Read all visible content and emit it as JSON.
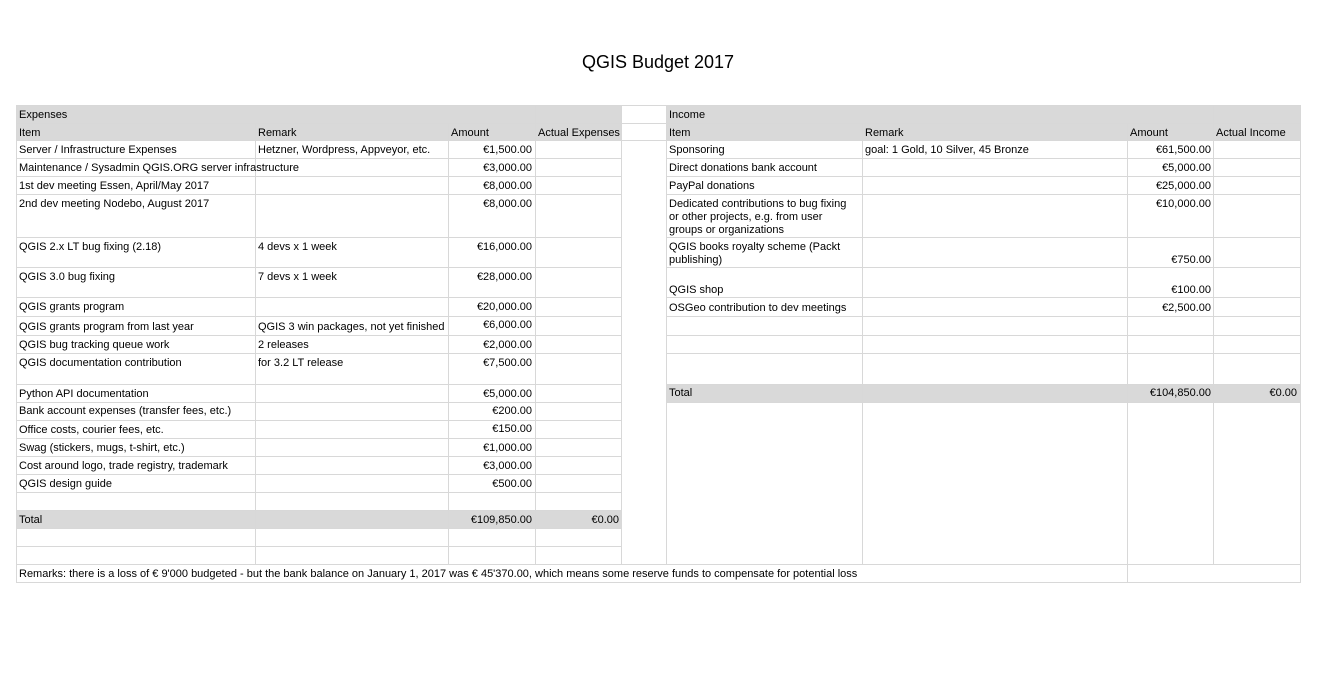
{
  "title": "QGIS Budget 2017",
  "expenses": {
    "section": "Expenses",
    "headers": {
      "item": "Item",
      "remark": "Remark",
      "amount": "Amount",
      "actual": "Actual Expenses"
    },
    "rows": [
      {
        "item": "Server / Infrastructure Expenses",
        "remark": "Hetzner, Wordpress, Appveyor, etc.",
        "amount": "€1,500.00"
      },
      {
        "item": "Maintenance / Sysadmin QGIS.ORG server infrastructure",
        "remark": "",
        "amount": "€3,000.00"
      },
      {
        "item": "1st dev meeting Essen, April/May 2017",
        "remark": "",
        "amount": "€8,000.00"
      },
      {
        "item": "2nd dev meeting Nodebo, August 2017",
        "remark": "",
        "amount": "€8,000.00"
      },
      {
        "item": "QGIS 2.x LT bug fixing (2.18)",
        "remark": "4 devs x 1 week",
        "amount": "€16,000.00"
      },
      {
        "item": "QGIS 3.0 bug fixing",
        "remark": "7 devs x 1 week",
        "amount": "€28,000.00"
      },
      {
        "item": "QGIS grants program",
        "remark": "",
        "amount": "€20,000.00"
      },
      {
        "item": "QGIS grants program from last year",
        "remark": "QGIS 3 win packages, not yet finished",
        "amount": "€6,000.00"
      },
      {
        "item": "QGIS bug tracking queue work",
        "remark": "2 releases",
        "amount": "€2,000.00"
      },
      {
        "item": "QGIS documentation contribution",
        "remark": "for 3.2 LT release",
        "amount": "€7,500.00"
      },
      {
        "item": "Python API documentation",
        "remark": "",
        "amount": "€5,000.00"
      },
      {
        "item": "Bank account expenses (transfer fees, etc.)",
        "remark": "",
        "amount": "€200.00"
      },
      {
        "item": "Office costs, courier fees, etc.",
        "remark": "",
        "amount": "€150.00"
      },
      {
        "item": "Swag (stickers, mugs, t-shirt, etc.)",
        "remark": "",
        "amount": "€1,000.00"
      },
      {
        "item": "Cost around logo, trade registry, trademark",
        "remark": "",
        "amount": "€3,000.00"
      },
      {
        "item": "QGIS design guide",
        "remark": "",
        "amount": "€500.00"
      }
    ],
    "total": {
      "label": "Total",
      "amount": "€109,850.00",
      "actual": "€0.00"
    }
  },
  "income": {
    "section": "Income",
    "headers": {
      "item": "Item",
      "remark": "Remark",
      "amount": "Amount",
      "actual": "Actual Income"
    },
    "rows": [
      {
        "item": "Sponsoring",
        "remark": "goal: 1 Gold, 10 Silver, 45 Bronze",
        "amount": "€61,500.00"
      },
      {
        "item": "Direct donations bank account",
        "remark": "",
        "amount": "€5,000.00"
      },
      {
        "item": "PayPal donations",
        "remark": "",
        "amount": "€25,000.00"
      },
      {
        "item": "Dedicated contributions to bug fixing or other projects, e.g. from user groups or organizations",
        "remark": "",
        "amount": "€10,000.00"
      },
      {
        "item": "QGIS books royalty scheme (Packt publishing)",
        "remark": "",
        "amount": "€750.00"
      },
      {
        "item": "QGIS shop",
        "remark": "",
        "amount": "€100.00"
      },
      {
        "item": "OSGeo contribution to dev meetings",
        "remark": "",
        "amount": "€2,500.00"
      }
    ],
    "total": {
      "label": "Total",
      "amount": "€104,850.00",
      "actual": "€0.00"
    }
  },
  "remarks": "Remarks: there is a loss of € 9'000 budgeted - but the bank balance on January 1, 2017 was € 45'370.00, which means some reserve funds to compensate for potential loss"
}
